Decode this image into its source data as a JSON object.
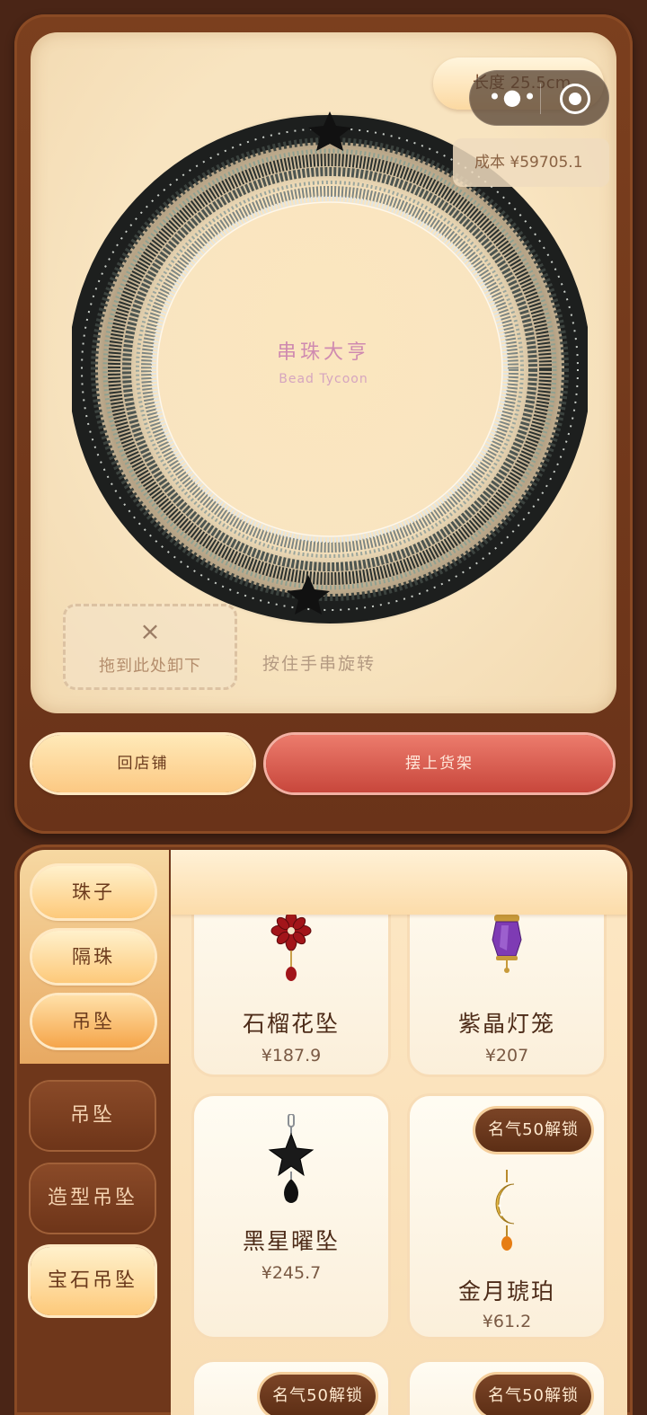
{
  "stage": {
    "length_label": "长度 25.5cm",
    "cost_label": "成本 ¥59705.1",
    "brand_title": "串珠大亨",
    "brand_subtitle": "Bead Tycoon",
    "drop_zone_icon": "×",
    "drop_zone_label": "拖到此处卸下",
    "rotate_hint": "按住手串旋转"
  },
  "capsule": {
    "more_icon": "more-dots-icon",
    "close_icon": "target-close-icon"
  },
  "actions": {
    "back_to_shop": "回店铺",
    "put_on_shelf": "摆上货架"
  },
  "categories": [
    {
      "label": "珠子",
      "active": false
    },
    {
      "label": "隔珠",
      "active": false
    },
    {
      "label": "吊坠",
      "active": true
    }
  ],
  "subcategories": [
    {
      "label": "吊坠",
      "active": false
    },
    {
      "label": "造型吊坠",
      "active": false
    },
    {
      "label": "宝石吊坠",
      "active": true
    }
  ],
  "items": [
    {
      "name": "石榴花坠",
      "price": "¥187.9",
      "icon": "garnet-flower-pendant-icon"
    },
    {
      "name": "紫晶灯笼",
      "price": "¥207",
      "icon": "amethyst-lantern-pendant-icon"
    },
    {
      "name": "黑星曜坠",
      "price": "¥245.7",
      "icon": "black-star-pendant-icon"
    },
    {
      "name": "金月琥珀",
      "price": "¥61.2",
      "icon": "gold-moon-amber-pendant-icon",
      "lock": "名气50解锁"
    },
    {
      "name": "",
      "price": "",
      "icon": "",
      "lock": "名气50解锁"
    },
    {
      "name": "",
      "price": "",
      "icon": "",
      "lock": "名气50解锁"
    }
  ],
  "colors": {
    "frame_brown": "#6f371b",
    "stage_cream": "#fbe6bf",
    "primary_red": "#c8473c",
    "button_gold": "#fcc983"
  }
}
